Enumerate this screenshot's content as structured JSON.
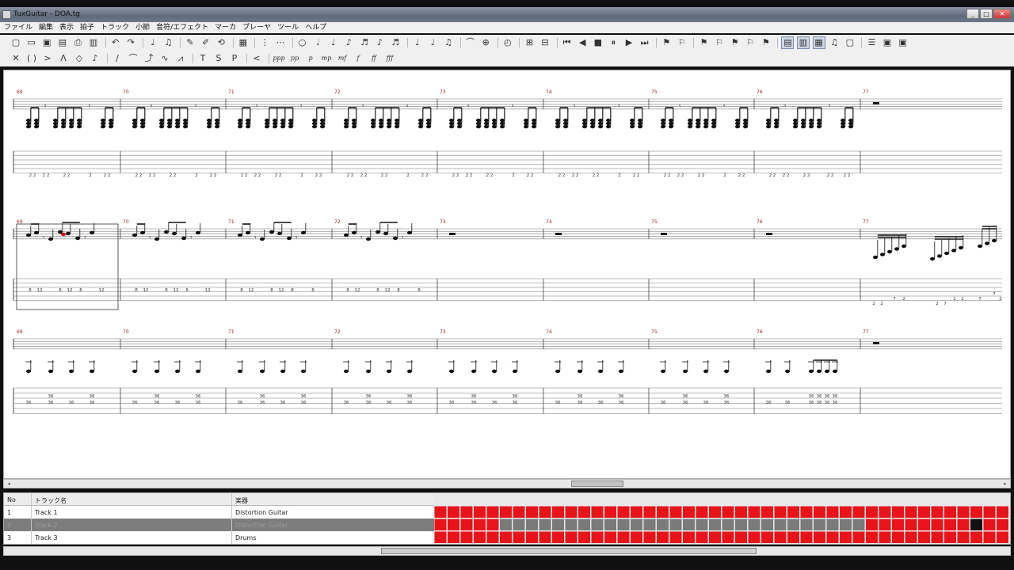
{
  "window": {
    "title": "TuxGuitar - DOA.tg",
    "buttons": [
      "_",
      "□",
      "✕"
    ]
  },
  "menu": [
    "ファイル",
    "編集",
    "表示",
    "拍子",
    "トラック",
    "小節",
    "音符/エフェクト",
    "マーカ",
    "プレーヤ",
    "ツール",
    "ヘルプ"
  ],
  "toolbar1": [
    "new-icon",
    "open-icon",
    "save-icon",
    "save-as-icon",
    "print-icon",
    "print-preview-icon",
    "|",
    "undo-icon",
    "redo-icon",
    "|",
    "tempo-icon",
    "time-sig-icon",
    "|",
    "edit-mode-icon",
    "edit-tool-icon",
    "repeat-icon",
    "|",
    "layout-icon",
    "|",
    "voice1-icon",
    "voice2-icon",
    "|",
    "whole-note-icon",
    "half-note-icon",
    "quarter-note-icon",
    "eighth-note-icon",
    "sixteenth-note-icon",
    "thirtysecond-note-icon",
    "sixtyfourth-note-icon",
    "|",
    "dotted-icon",
    "double-dotted-icon",
    "tuplet-icon",
    "|",
    "tie-icon",
    "chord-icon",
    "|",
    "metronome-icon",
    "|",
    "add-measure-icon",
    "remove-measure-icon",
    "|",
    "first-icon",
    "previous-icon",
    "stop-icon",
    "pause-icon",
    "next-icon",
    "last-icon",
    "|",
    "marker1-icon",
    "marker2-icon",
    "|",
    "marker3-icon",
    "marker4-icon",
    "marker5-icon",
    "marker6-icon",
    "marker7-icon",
    "|",
    "view-score-icon",
    "view-tab-icon",
    "view-both-icon",
    "view-multi-icon",
    "view-page-icon",
    "|",
    "mixer-icon",
    "transport-icon",
    "settings-icon"
  ],
  "toolbar2": [
    "dead-note-icon",
    "ghost-note-icon",
    "accent-icon",
    "heavy-accent-icon",
    "harmonic-icon",
    "grace-icon",
    "|",
    "slide-icon",
    "hammer-icon",
    "bend-icon",
    "vibrato-icon",
    "tremolo-bar-icon",
    "|",
    "tapping-icon",
    "slap-icon",
    "popping-icon",
    "|",
    "fade-in-icon",
    "|",
    "ppp-icon",
    "pp-icon",
    "p-icon",
    "mp-icon",
    "mf-icon",
    "f-icon",
    "ff-icon",
    "fff-icon"
  ],
  "toolbar1_highlight": [
    "view-score-icon",
    "view-tab-icon",
    "view-both-icon"
  ],
  "score": {
    "measure_numbers": [
      "69",
      "70",
      "71",
      "72",
      "73",
      "74",
      "75",
      "76",
      "77"
    ],
    "systems": [
      {
        "name": "track-1-distortion-guitar",
        "tab_labels": [
          [
            "2 2",
            "2 2",
            "2 2",
            "2",
            "2 2"
          ],
          [
            "2 2",
            "2 2",
            "2 2",
            "2",
            "2 2"
          ],
          [
            "2 2",
            "2 2",
            "2 2",
            "2",
            "2 2"
          ],
          [
            "2 2",
            "2 2",
            "2 2",
            "2",
            "2 2"
          ],
          [
            "2 2",
            "2 2",
            "2 2",
            "2",
            "2 2"
          ],
          [
            "2 2",
            "2 2",
            "2 2",
            "2",
            "2 2"
          ],
          [
            "2 2",
            "2 2",
            "2 2",
            "2",
            "2 2"
          ],
          [
            "2 2",
            "2 2",
            "2 2",
            "2 2",
            "2 2"
          ]
        ]
      },
      {
        "name": "track-2-distortion-guitar",
        "tab_labels": [
          [
            "8",
            "12",
            "8",
            "12",
            "8",
            "12"
          ],
          [
            "8",
            "12",
            "8",
            "12",
            "8",
            "12"
          ],
          [
            "8",
            "12",
            "8",
            "12",
            "8",
            "8"
          ],
          [
            "8",
            "12",
            "8",
            "12",
            "8",
            "8"
          ],
          [],
          [],
          [],
          [],
          [
            "2",
            "2",
            "7",
            "2",
            "2",
            "7",
            "2",
            "2",
            "7",
            "7",
            "2"
          ]
        ]
      },
      {
        "name": "track-3-drums",
        "tab_labels": [
          "36",
          "36",
          "36",
          "36"
        ]
      }
    ]
  },
  "tracks": {
    "headers": {
      "no": "No",
      "name": "トラック名",
      "instrument": "楽器"
    },
    "rows": [
      {
        "no": "1",
        "name": "Track 1",
        "instrument": "Distortion Guitar"
      },
      {
        "no": "2",
        "name": "Track 2",
        "instrument": "Distortion Guitar"
      },
      {
        "no": "3",
        "name": "Track 3",
        "instrument": "Drums"
      }
    ],
    "selected_row": 2,
    "grid_colors": {
      "filled": "#e8141a",
      "empty": "#7a7a7a",
      "cursor": "#111111"
    },
    "grid": [
      [
        1,
        1,
        1,
        1,
        1,
        1,
        1,
        1,
        1,
        1,
        1,
        1,
        1,
        1,
        1,
        1,
        1,
        1,
        1,
        1,
        1,
        1,
        1,
        1,
        1,
        1,
        1,
        1,
        1,
        1,
        1,
        1,
        1,
        1,
        1,
        1,
        1,
        1,
        1,
        1,
        1,
        1,
        1,
        1,
        1,
        1,
        1,
        0,
        0,
        0,
        0,
        1,
        1,
        1,
        1,
        1,
        1,
        1,
        1,
        1,
        1,
        1,
        1,
        1,
        1,
        1,
        1,
        1,
        1,
        1,
        1,
        1,
        1,
        1,
        1,
        1,
        1,
        1,
        1,
        1,
        1,
        1,
        1,
        1,
        1,
        1,
        1,
        1,
        1,
        1,
        1,
        1,
        1,
        1,
        1,
        1,
        1,
        1,
        1,
        1
      ],
      [
        1,
        1,
        1,
        1,
        1,
        0,
        0,
        0,
        0,
        0,
        0,
        0,
        0,
        0,
        0,
        0,
        0,
        0,
        0,
        0,
        0,
        0,
        0,
        0,
        0,
        0,
        0,
        0,
        0,
        0,
        0,
        0,
        0,
        1,
        1,
        1,
        1,
        1,
        1,
        1,
        1,
        2,
        1,
        1,
        1,
        1,
        1,
        1,
        1,
        1,
        0,
        0,
        0,
        0,
        0,
        0,
        0,
        0,
        1,
        1,
        1,
        1,
        1,
        1,
        1,
        1,
        1,
        1,
        1,
        1,
        1,
        0,
        0,
        0,
        0,
        0,
        0,
        0,
        0,
        1,
        1,
        1,
        1,
        1,
        1,
        1,
        1,
        1,
        1,
        1,
        1,
        1,
        0,
        0,
        0,
        0,
        0,
        0,
        0,
        0
      ],
      [
        1,
        1,
        1,
        1,
        1,
        1,
        1,
        1,
        1,
        1,
        1,
        1,
        1,
        1,
        1,
        1,
        1,
        1,
        1,
        1,
        1,
        1,
        1,
        1,
        1,
        1,
        1,
        1,
        1,
        1,
        1,
        1,
        1,
        1,
        1,
        1,
        1,
        1,
        1,
        1,
        1,
        1,
        1,
        1,
        1,
        1,
        1,
        1,
        1,
        1,
        1,
        1,
        1,
        1,
        1,
        1,
        1,
        1,
        1,
        1,
        1,
        1,
        1,
        0,
        1,
        1,
        1,
        1,
        1,
        1,
        1,
        1,
        1,
        1,
        1,
        1,
        1,
        1,
        1,
        1,
        1,
        1,
        1,
        1,
        1,
        1,
        1,
        1,
        1,
        1,
        1,
        1,
        1,
        1,
        1,
        1,
        1,
        1,
        1,
        1
      ]
    ]
  }
}
